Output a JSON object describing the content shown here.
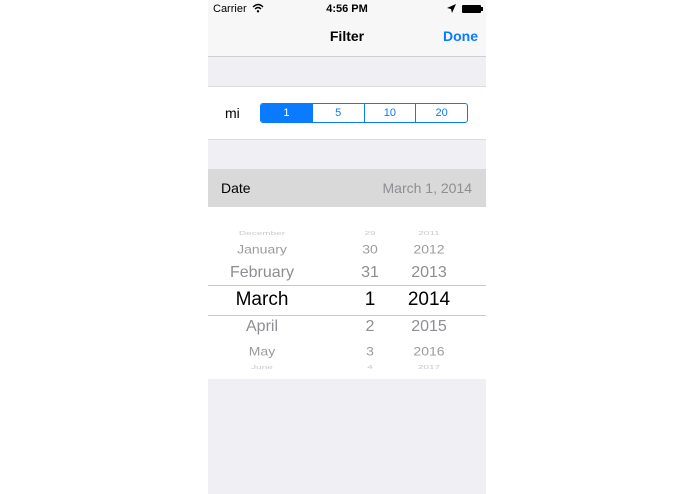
{
  "status_bar": {
    "carrier": "Carrier",
    "time": "4:56 PM"
  },
  "nav": {
    "title": "Filter",
    "done_label": "Done"
  },
  "distance": {
    "unit_label": "mi",
    "options": [
      "1",
      "5",
      "10",
      "20"
    ],
    "selected": "1"
  },
  "date_row": {
    "label": "Date",
    "value": "March 1, 2014"
  },
  "picker": {
    "months": [
      "December",
      "January",
      "February",
      "March",
      "April",
      "May",
      "June"
    ],
    "days": [
      "29",
      "30",
      "31",
      "1",
      "2",
      "3",
      "4"
    ],
    "years": [
      "2011",
      "2012",
      "2013",
      "2014",
      "2015",
      "2016",
      "2017"
    ],
    "selected": {
      "month": "March",
      "day": "1",
      "year": "2014"
    }
  },
  "colors": {
    "accent": "#0a7aff",
    "background": "#efeff4",
    "date_row": "#d9d9d9"
  },
  "icons": [
    "wifi-icon",
    "location-icon",
    "battery-icon"
  ]
}
